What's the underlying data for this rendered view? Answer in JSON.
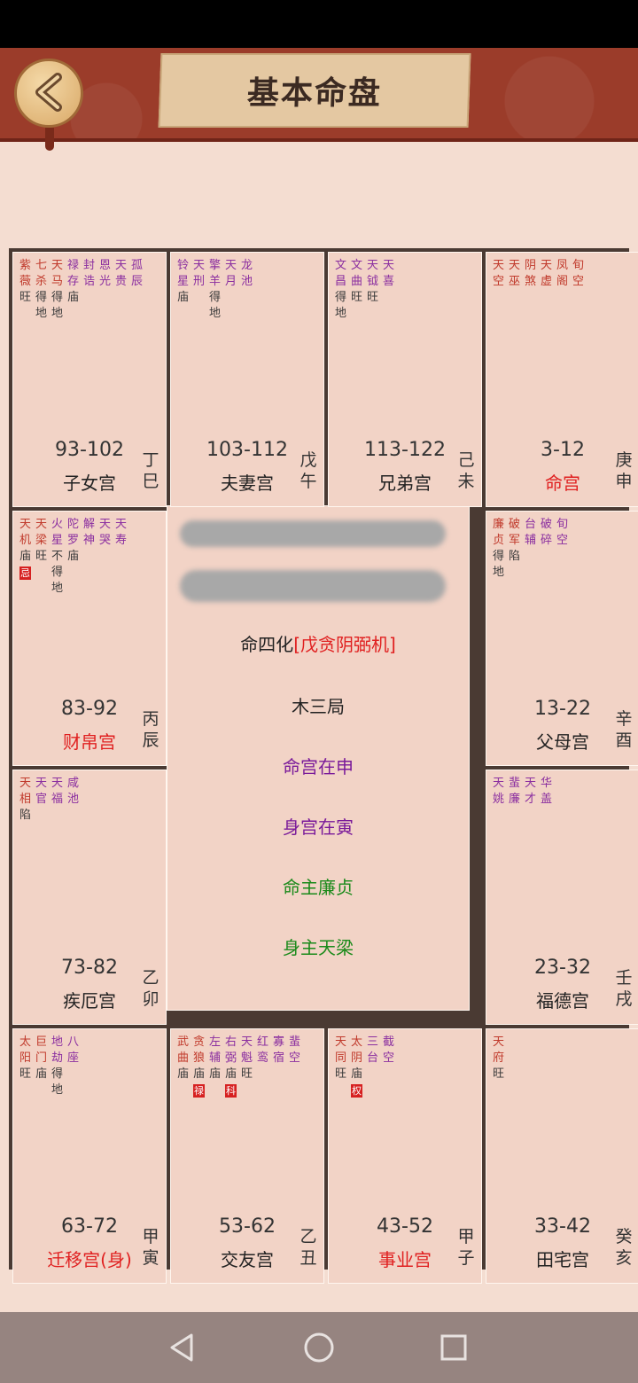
{
  "header": {
    "title": "基本命盘"
  },
  "colors": {
    "red": "#e02020",
    "purple": "#7a1a9a",
    "green": "#1a8a1a",
    "star_red": "#c0392b",
    "star_purple": "#8b2fa0",
    "brightness": "#333333"
  },
  "palaces": [
    {
      "id": "zinv",
      "range": "93-102",
      "name": "子女宫",
      "ganzhi": [
        "丁",
        "巳"
      ],
      "name_red": false,
      "stars": [
        {
          "n": [
            "紫",
            "薇"
          ],
          "b": "旺",
          "c": "r"
        },
        {
          "n": [
            "七",
            "杀"
          ],
          "b": "得",
          "b2": "地",
          "c": "r"
        },
        {
          "n": [
            "天",
            "马"
          ],
          "b": "得",
          "b2": "地",
          "c": "r"
        },
        {
          "n": [
            "禄",
            "存"
          ],
          "b": "庙",
          "c": "p"
        },
        {
          "n": [
            "封",
            "诰"
          ],
          "c": "p"
        },
        {
          "n": [
            "恩",
            "光"
          ],
          "c": "p"
        },
        {
          "n": [
            "天",
            "贵"
          ],
          "c": "p"
        },
        {
          "n": [
            "孤",
            "辰"
          ],
          "c": "p"
        }
      ]
    },
    {
      "id": "fuqi",
      "range": "103-112",
      "name": "夫妻宫",
      "ganzhi": [
        "戊",
        "午"
      ],
      "name_red": false,
      "stars": [
        {
          "n": [
            "铃",
            "星"
          ],
          "b": "庙",
          "c": "p"
        },
        {
          "n": [
            "天",
            "刑"
          ],
          "c": "p"
        },
        {
          "n": [
            "擎",
            "羊"
          ],
          "b": "得",
          "b2": "地",
          "c": "p"
        },
        {
          "n": [
            "天",
            "月"
          ],
          "c": "p"
        },
        {
          "n": [
            "龙",
            "池"
          ],
          "c": "p"
        }
      ]
    },
    {
      "id": "xiongdi",
      "range": "113-122",
      "name": "兄弟宫",
      "ganzhi": [
        "己",
        "未"
      ],
      "name_red": false,
      "stars": [
        {
          "n": [
            "文",
            "昌"
          ],
          "b": "得",
          "b2": "地",
          "c": "p"
        },
        {
          "n": [
            "文",
            "曲"
          ],
          "b": "旺",
          "c": "p"
        },
        {
          "n": [
            "天",
            "钺"
          ],
          "b": "旺",
          "c": "p"
        },
        {
          "n": [
            "天",
            "喜"
          ],
          "c": "p"
        }
      ]
    },
    {
      "id": "ming",
      "range": "3-12",
      "name": "命宫",
      "ganzhi": [
        "庚",
        "申"
      ],
      "name_red": true,
      "stars": [
        {
          "n": [
            "天",
            "空"
          ],
          "c": "r"
        },
        {
          "n": [
            "天",
            "巫"
          ],
          "c": "r"
        },
        {
          "n": [
            "阴",
            "煞"
          ],
          "c": "r"
        },
        {
          "n": [
            "天",
            "虚"
          ],
          "c": "r"
        },
        {
          "n": [
            "凤",
            "阁"
          ],
          "c": "r"
        },
        {
          "n": [
            "旬",
            "空"
          ],
          "c": "r"
        }
      ]
    },
    {
      "id": "caibo",
      "range": "83-92",
      "name": "财帛宫",
      "ganzhi": [
        "丙",
        "辰"
      ],
      "name_red": true,
      "stars": [
        {
          "n": [
            "天",
            "机"
          ],
          "b": "庙",
          "h": "忌",
          "c": "r"
        },
        {
          "n": [
            "天",
            "梁"
          ],
          "b": "旺",
          "c": "r"
        },
        {
          "n": [
            "火",
            "星"
          ],
          "b": "不",
          "b2": "得",
          "b3": "地",
          "c": "p"
        },
        {
          "n": [
            "陀",
            "罗"
          ],
          "b": "庙",
          "c": "p"
        },
        {
          "n": [
            "解",
            "神"
          ],
          "c": "p"
        },
        {
          "n": [
            "天",
            "哭"
          ],
          "c": "p"
        },
        {
          "n": [
            "天",
            "寿"
          ],
          "c": "p"
        }
      ]
    },
    {
      "id": "fumu",
      "range": "13-22",
      "name": "父母宫",
      "ganzhi": [
        "辛",
        "酉"
      ],
      "name_red": false,
      "stars": [
        {
          "n": [
            "廉",
            "贞"
          ],
          "b": "得",
          "b2": "地",
          "c": "r"
        },
        {
          "n": [
            "破",
            "军"
          ],
          "b": "陷",
          "c": "r"
        },
        {
          "n": [
            "台",
            "辅"
          ],
          "c": "p"
        },
        {
          "n": [
            "破",
            "碎"
          ],
          "c": "p"
        },
        {
          "n": [
            "旬",
            "空"
          ],
          "c": "p"
        }
      ]
    },
    {
      "id": "jie",
      "range": "73-82",
      "name": "疾厄宫",
      "ganzhi": [
        "乙",
        "卯"
      ],
      "name_red": false,
      "stars": [
        {
          "n": [
            "天",
            "相"
          ],
          "b": "陷",
          "c": "r"
        },
        {
          "n": [
            "天",
            "官"
          ],
          "c": "p"
        },
        {
          "n": [
            "天",
            "福"
          ],
          "c": "p"
        },
        {
          "n": [
            "咸",
            "池"
          ],
          "c": "p"
        }
      ]
    },
    {
      "id": "fude",
      "range": "23-32",
      "name": "福德宫",
      "ganzhi": [
        "壬",
        "戌"
      ],
      "name_red": false,
      "stars": [
        {
          "n": [
            "天",
            "姚"
          ],
          "c": "p"
        },
        {
          "n": [
            "蜚",
            "廉"
          ],
          "c": "p"
        },
        {
          "n": [
            "天",
            "才"
          ],
          "c": "p"
        },
        {
          "n": [
            "华",
            "盖"
          ],
          "c": "p"
        }
      ]
    },
    {
      "id": "qianyi",
      "range": "63-72",
      "name": "迁移宫(身)",
      "ganzhi": [
        "甲",
        "寅"
      ],
      "name_red": true,
      "stars": [
        {
          "n": [
            "太",
            "阳"
          ],
          "b": "旺",
          "c": "r"
        },
        {
          "n": [
            "巨",
            "门"
          ],
          "b": "庙",
          "c": "r"
        },
        {
          "n": [
            "地",
            "劫"
          ],
          "b": "得",
          "b2": "地",
          "c": "p"
        },
        {
          "n": [
            "八",
            "座"
          ],
          "c": "p"
        }
      ]
    },
    {
      "id": "jiaoyou",
      "range": "53-62",
      "name": "交友宫",
      "ganzhi": [
        "乙",
        "丑"
      ],
      "name_red": false,
      "stars": [
        {
          "n": [
            "武",
            "曲"
          ],
          "b": "庙",
          "c": "r"
        },
        {
          "n": [
            "贪",
            "狼"
          ],
          "b": "庙",
          "h": "禄",
          "c": "r"
        },
        {
          "n": [
            "左",
            "辅"
          ],
          "b": "庙",
          "c": "p"
        },
        {
          "n": [
            "右",
            "弼"
          ],
          "b": "庙",
          "h": "科",
          "c": "p"
        },
        {
          "n": [
            "天",
            "魁"
          ],
          "b": "旺",
          "c": "p"
        },
        {
          "n": [
            "红",
            "鸾"
          ],
          "c": "p"
        },
        {
          "n": [
            "寡",
            "宿"
          ],
          "c": "p"
        },
        {
          "n": [
            "蜚",
            "空"
          ],
          "c": "p"
        }
      ]
    },
    {
      "id": "shiye",
      "range": "43-52",
      "name": "事业宫",
      "ganzhi": [
        "甲",
        "子"
      ],
      "name_red": true,
      "stars": [
        {
          "n": [
            "天",
            "同"
          ],
          "b": "旺",
          "c": "r"
        },
        {
          "n": [
            "太",
            "阴"
          ],
          "b": "庙",
          "h": "权",
          "c": "r"
        },
        {
          "n": [
            "三",
            "台"
          ],
          "c": "p"
        },
        {
          "n": [
            "截",
            "空"
          ],
          "c": "p"
        }
      ]
    },
    {
      "id": "tianzhai",
      "range": "33-42",
      "name": "田宅宫",
      "ganzhi": [
        "癸",
        "亥"
      ],
      "name_red": false,
      "stars": [
        {
          "n": [
            "天",
            "府"
          ],
          "b": "旺",
          "c": "r"
        }
      ]
    }
  ],
  "center": {
    "sihua_prefix": "命四化",
    "sihua_value": "[戊贪阴弼机]",
    "ju": "木三局",
    "minggong": "命宫在申",
    "shengong": "身宫在寅",
    "mingzhu": "命主廉贞",
    "shenzhu": "身主天梁"
  }
}
